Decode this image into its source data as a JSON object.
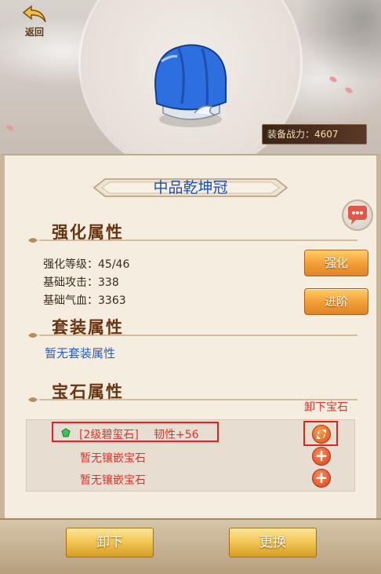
{
  "back": {
    "label": "返回"
  },
  "power": {
    "text": "装备战力：4607"
  },
  "item": {
    "name": "中品乾坤冠"
  },
  "enhance": {
    "section_title": "强化属性",
    "level_label": "强化等级：45/46",
    "attack_label": "基础攻击：338",
    "hp_label": "基础气血：3363",
    "enhance_button": "强化",
    "advance_button": "进阶"
  },
  "set": {
    "section_title": "套装属性",
    "none_text": "暂无套装属性"
  },
  "gems": {
    "section_title": "宝石属性",
    "unload_label": "卸下宝石",
    "slots": [
      {
        "name": "[2级碧玺石]",
        "stat": "韧性+56"
      },
      {
        "empty": "暂无镶嵌宝石"
      },
      {
        "empty": "暂无镶嵌宝石"
      }
    ]
  },
  "actions": {
    "unequip": "卸下",
    "replace": "更换"
  },
  "colors": {
    "title_blue": "#1f4fb0",
    "section_brown": "#6a3410",
    "highlight_red": "#e2231a",
    "button_orange": "#f3a137"
  },
  "icons": {
    "back": "back-arrow-icon",
    "chat": "chat-bubble-icon",
    "gem": "gem-icon",
    "unload": "refresh-icon",
    "add": "plus-icon"
  }
}
